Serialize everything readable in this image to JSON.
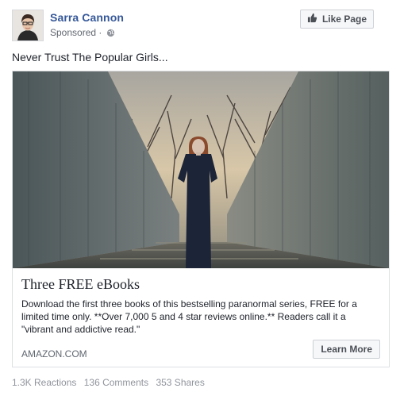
{
  "header": {
    "page_name": "Sarra Cannon",
    "sponsored_label": "Sponsored",
    "sponsored_separator": "·",
    "like_button_label": "Like Page",
    "icons": {
      "avatar": "profile-photo",
      "globe": "globe-icon",
      "like": "thumbs-up-icon"
    }
  },
  "post": {
    "text": "Never Trust The Popular Girls..."
  },
  "attachment": {
    "image_alt": "ad-photo",
    "headline": "Three FREE eBooks",
    "description": "Download the first three books of this bestselling paranormal series, FREE for a limited time only. **Over 7,000 5 and 4 star reviews online.** Readers call it a \"vibrant and addictive read.\"",
    "domain": "AMAZON.COM",
    "cta_label": "Learn More"
  },
  "stats": {
    "reactions": "1.3K Reactions",
    "comments": "136 Comments",
    "shares": "353 Shares"
  },
  "colors": {
    "link_blue": "#365899",
    "text": "#1d2129",
    "meta_gray": "#90949c",
    "border": "#dddfe2",
    "button_bg": "#f6f7f9"
  }
}
